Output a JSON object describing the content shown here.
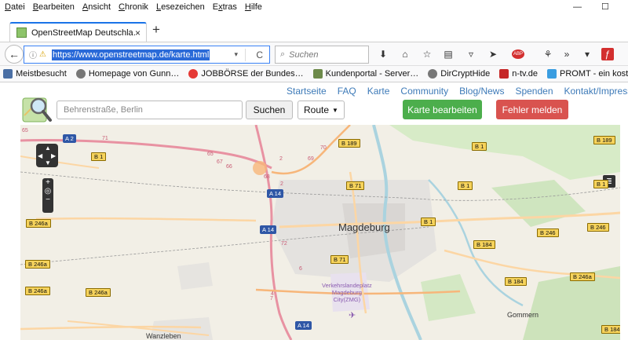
{
  "menubar": {
    "items": [
      "Datei",
      "Bearbeiten",
      "Ansicht",
      "Chronik",
      "Lesezeichen",
      "Extras",
      "Hilfe"
    ],
    "accesskeys": [
      "D",
      "B",
      "A",
      "C",
      "L",
      "x",
      "H"
    ],
    "minimize": "—",
    "maximize": "☐"
  },
  "tab": {
    "title": "OpenStreetMap Deutschla…",
    "close": "×",
    "new_tab": "+"
  },
  "navbar": {
    "back": "←",
    "info": "ⓘ",
    "warning": "⚠",
    "url": "https://www.openstreetmap.de/karte.html",
    "dropdown": "▾",
    "reload": "C",
    "search_placeholder": "Suchen",
    "abp": "ABP"
  },
  "bookmarks": [
    {
      "label": "Meistbesucht",
      "icon": "bookmark-star-icon",
      "color": "#4a6fa5"
    },
    {
      "label": "Homepage von Gunn…",
      "icon": "globe-icon",
      "color": "#777777"
    },
    {
      "label": "JOBBÖRSE der Bundes…",
      "icon": "arbeitsagentur-icon",
      "color": "#e53935"
    },
    {
      "label": "Kundenportal - Server…",
      "icon": "server-icon",
      "color": "#6d8a4a"
    },
    {
      "label": "DirCryptHide",
      "icon": "globe-icon",
      "color": "#777777"
    },
    {
      "label": "n-tv.de",
      "icon": "ntv-icon",
      "color": "#c62828"
    },
    {
      "label": "PROMT - ein kostenlo…",
      "icon": "promt-icon",
      "color": "#3a9de0"
    }
  ],
  "osm": {
    "links": [
      "Startseite",
      "FAQ",
      "Karte",
      "Community",
      "Blog/News",
      "Spenden",
      "Kontakt/Impressum"
    ],
    "search_placeholder": "Behrenstraße, Berlin",
    "search_button": "Suchen",
    "route_button": "Route",
    "edit_button": "Karte bearbeiten",
    "report_button": "Fehler melden",
    "edit_color": "#4cae4c",
    "report_color": "#d9534f"
  },
  "map": {
    "zoom_in": "+",
    "zoom_out": "−",
    "locate": "◎",
    "layers": "≣",
    "city": "Magdeburg",
    "town_bottom_left": "Wanzleben",
    "town_bottom_right": "Gommern",
    "airport": "Verkehrslandeplatz\nMagdeburg\nCity(ZMG)",
    "airport_symbol": "✈",
    "federal_roads": [
      "B 189",
      "B 1",
      "B 71",
      "B 1",
      "B 71",
      "B 246",
      "B 246",
      "B 184",
      "B 246a",
      "B 246a",
      "B 184",
      "B 246a",
      "B 246a",
      "B 1",
      "B 189",
      "B 1",
      "B 1",
      "B 246a",
      "B 184"
    ],
    "autobahns": [
      "A 2",
      "A 14",
      "A 14",
      "A 14"
    ],
    "exit_numbers": [
      "65",
      "67",
      "68",
      "69",
      "70",
      "71",
      "72",
      "2",
      "2",
      "4",
      "6",
      "65",
      "66",
      "7"
    ]
  },
  "colors": {
    "accent": "#2a6ad8",
    "link": "#3d7ab8",
    "autobahn": "#e892a2",
    "primary_road": "#fcd6a4",
    "forest": "#add19e",
    "urban": "#e0dfdf",
    "water": "#aad3df"
  }
}
